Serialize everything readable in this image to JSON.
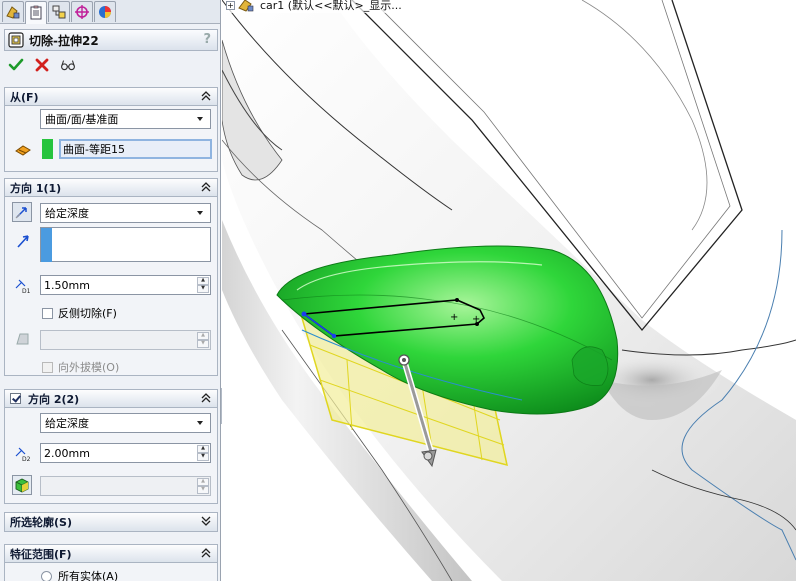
{
  "feature": {
    "title": "切除-拉伸22",
    "help": "?"
  },
  "tabs": [
    {
      "name": "feature-manager-tab-icon",
      "active": false
    },
    {
      "name": "property-manager-tab-icon",
      "active": true
    },
    {
      "name": "configuration-manager-tab-icon",
      "active": false
    },
    {
      "name": "dimxpert-manager-tab-icon",
      "active": false
    },
    {
      "name": "display-manager-tab-icon",
      "active": false
    }
  ],
  "from": {
    "title": "从(F)",
    "start_condition": "曲面/面/基准面",
    "face": "曲面-等距15"
  },
  "direction1": {
    "title": "方向 1(1)",
    "end_condition": "给定深度",
    "depth": "1.50mm",
    "flip_side_cut": "反侧切除(F)",
    "draft_outward": "向外拔模(O)"
  },
  "direction2": {
    "title": "方向 2(2)",
    "end_condition": "给定深度",
    "depth": "2.00mm"
  },
  "selected_contours": {
    "title": "所选轮廓(S)"
  },
  "feature_scope": {
    "title": "特征范围(F)",
    "all_bodies": "所有实体(A)"
  },
  "viewport": {
    "tree_flyout": "car1  (默认<<默认>_显示..."
  },
  "colors": {
    "accent_green": "#22c23a",
    "cut_preview_yellow": "#e8e25a",
    "sketch_blue": "#1b3cf0"
  }
}
